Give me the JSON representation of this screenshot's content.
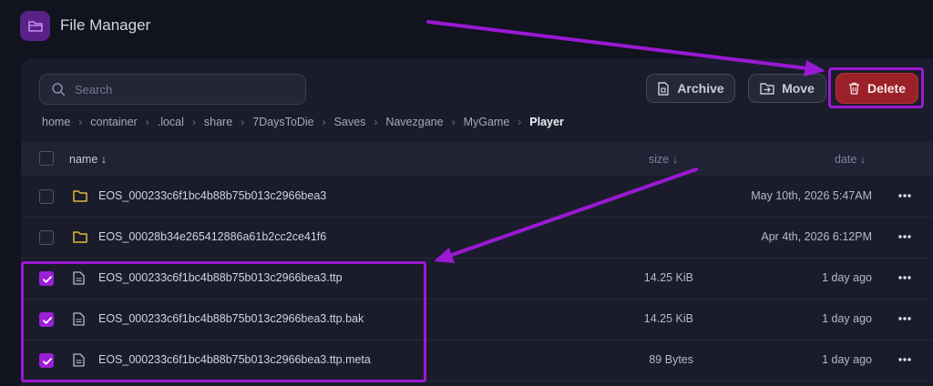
{
  "app": {
    "title": "File Manager",
    "logo_icon": "folder-icon",
    "accent_color": "#5a2188"
  },
  "toolbar": {
    "search_placeholder": "Search",
    "search_value": "",
    "archive_label": "Archive",
    "move_label": "Move",
    "delete_label": "Delete",
    "delete_color": "#9b2128"
  },
  "breadcrumb": [
    "home",
    "container",
    ".local",
    "share",
    "7DaysToDie",
    "Saves",
    "Navezgane",
    "MyGame",
    "Player"
  ],
  "table": {
    "headers": {
      "name": "name ↓",
      "size": "size ↓",
      "date": "date ↓"
    },
    "rows": [
      {
        "type": "folder",
        "name": "EOS_000233c6f1bc4b88b75b013c2966bea3",
        "size": "",
        "date": "May 10th, 2026 5:47AM",
        "checked": false
      },
      {
        "type": "folder",
        "name": "EOS_00028b34e265412886a61b2cc2ce41f6",
        "size": "",
        "date": "Apr 4th, 2026 6:12PM",
        "checked": false
      },
      {
        "type": "file",
        "name": "EOS_000233c6f1bc4b88b75b013c2966bea3.ttp",
        "size": "14.25 KiB",
        "date": "1 day ago",
        "checked": true
      },
      {
        "type": "file",
        "name": "EOS_000233c6f1bc4b88b75b013c2966bea3.ttp.bak",
        "size": "14.25 KiB",
        "date": "1 day ago",
        "checked": true
      },
      {
        "type": "file",
        "name": "EOS_000233c6f1bc4b88b75b013c2966bea3.ttp.meta",
        "size": "89 Bytes",
        "date": "1 day ago",
        "checked": true
      }
    ]
  },
  "annotation_color": "#9a19d2"
}
